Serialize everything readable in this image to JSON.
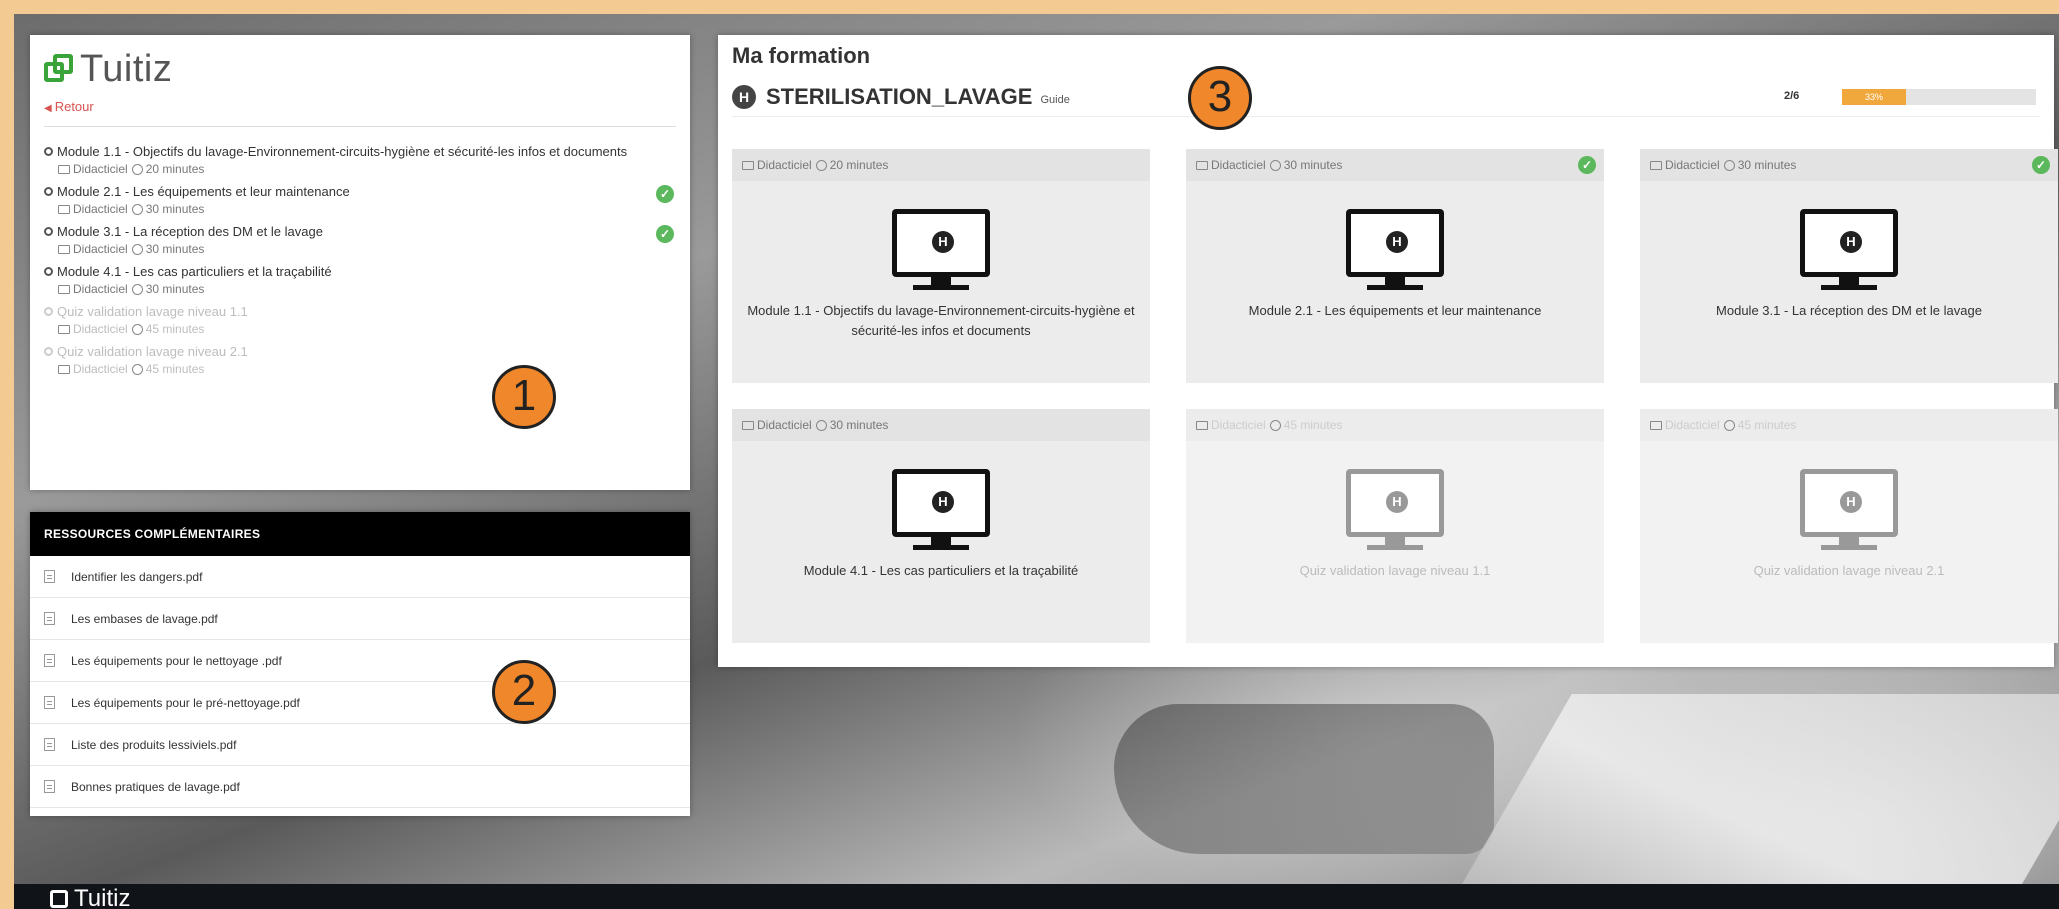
{
  "brand": {
    "name": "Tuitiz"
  },
  "sidebar": {
    "back_label": "Retour",
    "modules": [
      {
        "title": "Module 1.1 - Objectifs du lavage-Environnement-circuits-hygiène et sécurité-les infos et documents",
        "type": "Didacticiel",
        "duration": "20 minutes",
        "done": false,
        "disabled": false
      },
      {
        "title": "Module 2.1 - Les équipements et leur maintenance",
        "type": "Didacticiel",
        "duration": "30 minutes",
        "done": true,
        "disabled": false
      },
      {
        "title": "Module 3.1 - La réception des DM et le lavage",
        "type": "Didacticiel",
        "duration": "30 minutes",
        "done": true,
        "disabled": false
      },
      {
        "title": "Module 4.1 - Les cas particuliers et la traçabilité",
        "type": "Didacticiel",
        "duration": "30 minutes",
        "done": false,
        "disabled": false
      },
      {
        "title": "Quiz validation lavage niveau 1.1",
        "type": "Didacticiel",
        "duration": "45 minutes",
        "done": false,
        "disabled": true
      },
      {
        "title": "Quiz validation lavage niveau 2.1",
        "type": "Didacticiel",
        "duration": "45 minutes",
        "done": false,
        "disabled": true
      }
    ]
  },
  "resources": {
    "header": "RESSOURCES COMPLÉMENTAIRES",
    "items": [
      "Identifier les dangers.pdf",
      "Les embases de lavage.pdf",
      "Les équipements pour le nettoyage .pdf",
      "Les équipements pour le pré-nettoyage.pdf",
      "Liste des produits lessiviels.pdf",
      "Bonnes pratiques de lavage.pdf"
    ]
  },
  "main": {
    "title": "Ma formation",
    "course_name": "STERILISATION_LAVAGE",
    "course_type": "Guide",
    "progress_label": "2/6",
    "progress_fraction": 0.33,
    "progress_text": "33%",
    "cards": [
      {
        "type": "Didacticiel",
        "duration": "20 minutes",
        "label": "Module 1.1 - Objectifs du lavage-Environnement-circuits-hygiène et sécurité-les infos et documents",
        "done": false,
        "disabled": false
      },
      {
        "type": "Didacticiel",
        "duration": "30 minutes",
        "label": "Module 2.1 - Les équipements et leur maintenance",
        "done": true,
        "disabled": false
      },
      {
        "type": "Didacticiel",
        "duration": "30 minutes",
        "label": "Module 3.1 - La réception des DM et le lavage",
        "done": true,
        "disabled": false
      },
      {
        "type": "Didacticiel",
        "duration": "30 minutes",
        "label": "Module 4.1 - Les cas particuliers et la traçabilité",
        "done": false,
        "disabled": false
      },
      {
        "type": "Didacticiel",
        "duration": "45 minutes",
        "label": "Quiz validation lavage niveau 1.1",
        "done": false,
        "disabled": true
      },
      {
        "type": "Didacticiel",
        "duration": "45 minutes",
        "label": "Quiz validation lavage niveau 2.1",
        "done": false,
        "disabled": true
      }
    ]
  },
  "annotations": [
    "1",
    "2",
    "3"
  ],
  "footer": {
    "brand": "Tuitiz"
  },
  "colors": {
    "accent_green": "#3aa43a",
    "check_green": "#5cb85c",
    "progress": "#f0a83c",
    "annotation": "#f0872a",
    "back_link": "#d9534f"
  }
}
